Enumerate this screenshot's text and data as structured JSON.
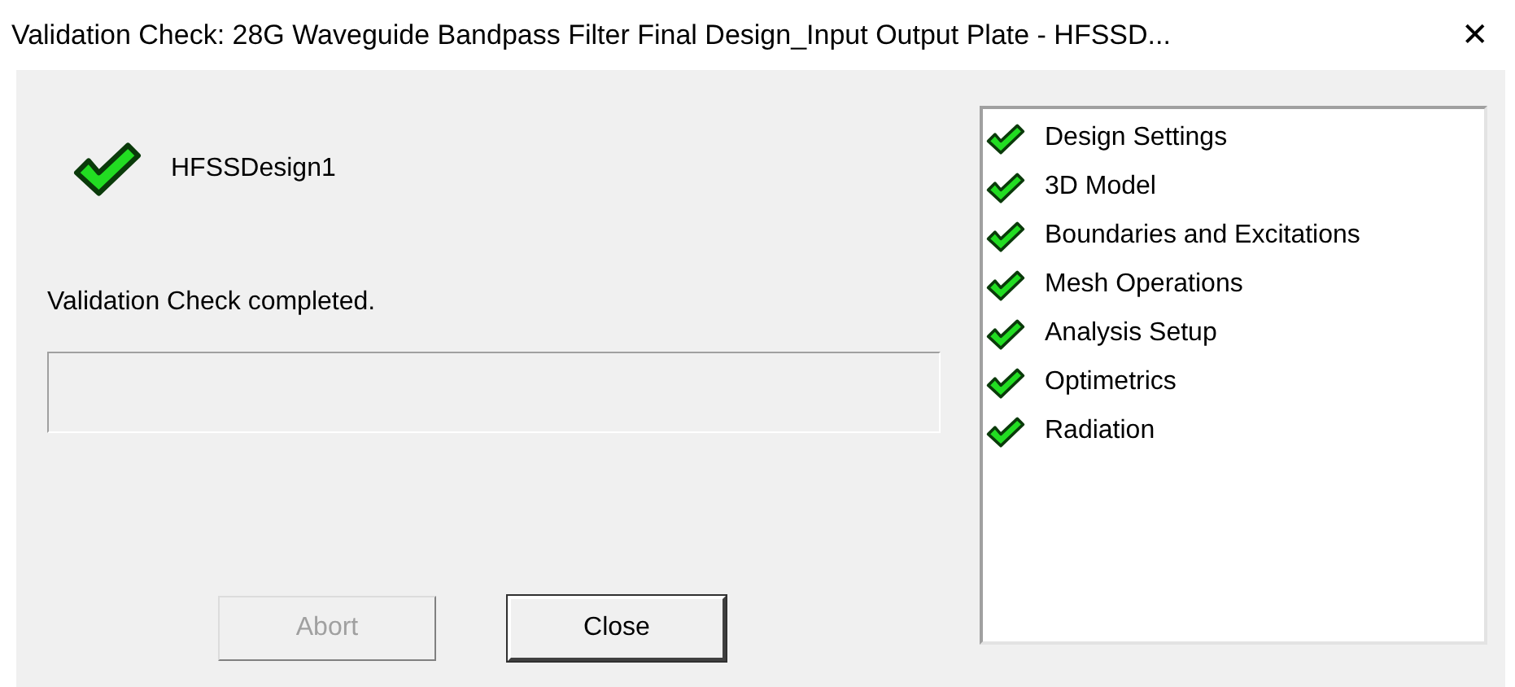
{
  "window": {
    "title": "Validation Check: 28G Waveguide Bandpass Filter Final Design_Input Output Plate - HFSSD...",
    "close": "✕"
  },
  "design": {
    "name": "HFSSDesign1",
    "checked": true
  },
  "message": "Validation Check completed.",
  "progress": {
    "level": 0
  },
  "buttons": [
    {
      "label": "Abort",
      "disabled": true
    },
    {
      "label": "Close",
      "disabled": false
    }
  ],
  "checks": [
    {
      "label": "Design Settings",
      "checked": true
    },
    {
      "label": "3D Model",
      "checked": true
    },
    {
      "label": "Boundaries and Excitations",
      "checked": true
    },
    {
      "label": "Mesh Operations",
      "checked": true
    },
    {
      "label": "Analysis Setup",
      "checked": true
    },
    {
      "label": "Optimetrics",
      "checked": true
    },
    {
      "label": "Radiation",
      "checked": true
    }
  ]
}
